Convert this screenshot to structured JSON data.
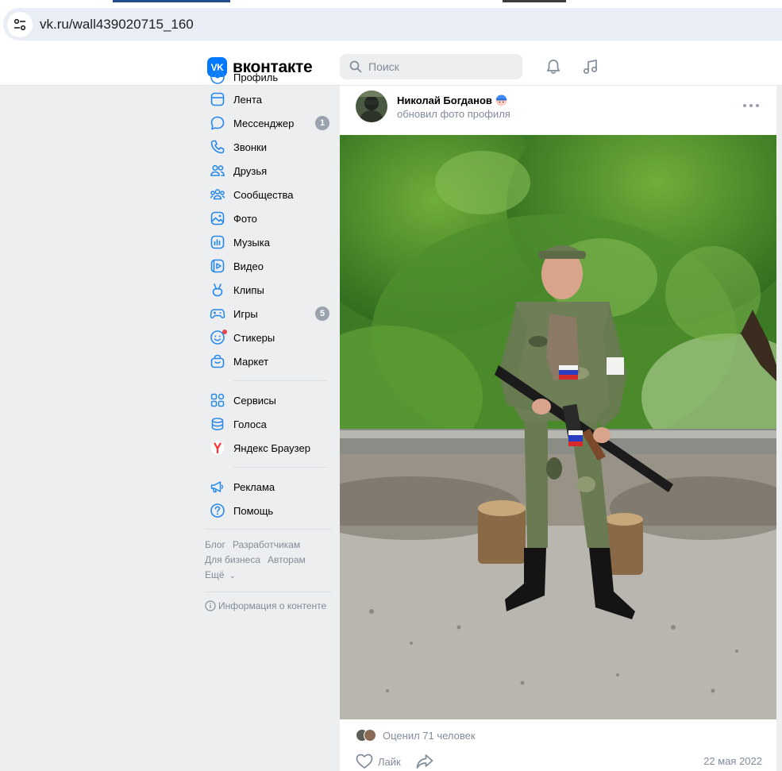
{
  "browser": {
    "url": "vk.ru/wall439020715_160"
  },
  "header": {
    "logo_text": "вконтакте",
    "logo_mark": "VK",
    "search_placeholder": "Поиск",
    "icons": [
      "bell-icon",
      "music-icon"
    ],
    "accent_color": "#0077ff"
  },
  "sidebar": {
    "items": [
      {
        "label": "Профиль",
        "icon": "profile-icon"
      },
      {
        "label": "Лента",
        "icon": "feed-icon"
      },
      {
        "label": "Мессенджер",
        "icon": "messenger-icon",
        "badge": "1"
      },
      {
        "label": "Звонки",
        "icon": "phone-icon"
      },
      {
        "label": "Друзья",
        "icon": "friends-icon"
      },
      {
        "label": "Сообщества",
        "icon": "communities-icon"
      },
      {
        "label": "Фото",
        "icon": "photo-icon"
      },
      {
        "label": "Музыка",
        "icon": "music-icon"
      },
      {
        "label": "Видео",
        "icon": "video-icon"
      },
      {
        "label": "Клипы",
        "icon": "clips-icon"
      },
      {
        "label": "Игры",
        "icon": "games-icon",
        "badge": "5"
      },
      {
        "label": "Стикеры",
        "icon": "stickers-icon"
      },
      {
        "label": "Маркет",
        "icon": "market-icon"
      }
    ],
    "items2": [
      {
        "label": "Сервисы",
        "icon": "services-icon"
      },
      {
        "label": "Голоса",
        "icon": "votes-icon"
      },
      {
        "label": "Яндекс Браузер",
        "icon": "yandex-icon"
      }
    ],
    "items3": [
      {
        "label": "Реклама",
        "icon": "ads-icon"
      },
      {
        "label": "Помощь",
        "icon": "help-icon"
      }
    ],
    "footer": {
      "row1": [
        "Блог",
        "Разработчикам"
      ],
      "row2": [
        "Для бизнеса",
        "Авторам"
      ],
      "more": "Ещё",
      "info": "Информация о контенте"
    }
  },
  "post": {
    "author": "Николай Богданов",
    "subtitle": "обновил фото профиля",
    "likes_text": "Оценил 71 человек",
    "like_label": "Лайк",
    "date": "22 мая 2022"
  }
}
